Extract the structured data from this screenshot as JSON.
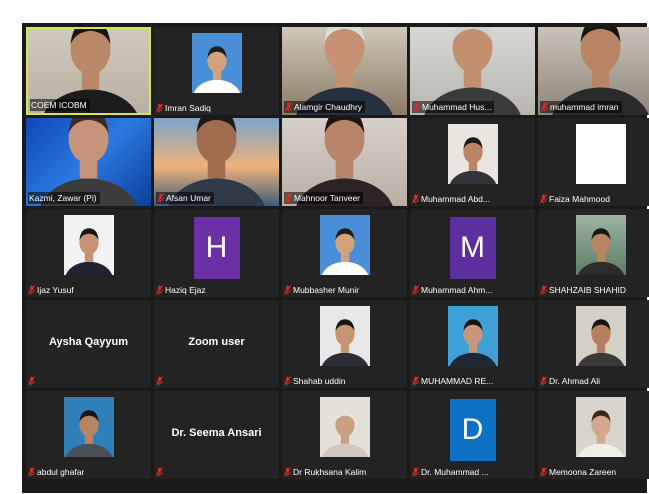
{
  "accent": "#d3e84f",
  "mute_color": "#e02b2b",
  "participants": [
    {
      "name": "COEM ICOBM",
      "mode": "video",
      "scene": "woman-dark",
      "active": true,
      "muted": false
    },
    {
      "name": "Imran Sadiq",
      "mode": "photo",
      "scene": "man-blue",
      "muted": true
    },
    {
      "name": "Alamgir Chaudhry",
      "mode": "video",
      "scene": "man-office",
      "muted": true
    },
    {
      "name": "Muhammad Hus...",
      "mode": "video",
      "scene": "man-office2",
      "muted": true
    },
    {
      "name": "muhammad imran",
      "mode": "video",
      "scene": "man-beard",
      "muted": true
    },
    {
      "name": "Kazmi, Zawar (Pi)",
      "mode": "video",
      "scene": "man-blue-bg",
      "muted": false
    },
    {
      "name": "Afsan Umar",
      "mode": "video",
      "scene": "man-bridge",
      "muted": true
    },
    {
      "name": "Mahnoor Tanveer",
      "mode": "video",
      "scene": "woman-headset",
      "muted": true
    },
    {
      "name": "Muhammad Abd...",
      "mode": "photo",
      "scene": "man-suit",
      "muted": true
    },
    {
      "name": "Faiza Mahmood",
      "mode": "photo",
      "scene": "blank",
      "muted": true
    },
    {
      "name": "Ijaz Yusuf",
      "mode": "photo",
      "scene": "man-suit2",
      "muted": true
    },
    {
      "name": "Haziq Ejaz",
      "mode": "initial",
      "initial": "H",
      "color": "#6b2fa6",
      "muted": true
    },
    {
      "name": "Mubbasher Munir",
      "mode": "photo",
      "scene": "man-blue",
      "muted": true
    },
    {
      "name": "Muhammad Ahm...",
      "mode": "initial",
      "initial": "M",
      "color": "#5c2e9e",
      "muted": true
    },
    {
      "name": "SHAHZAIB SHAHID",
      "mode": "photo",
      "scene": "man-outdoor",
      "muted": true
    },
    {
      "name": "Aysha Qayyum",
      "mode": "name",
      "muted": true
    },
    {
      "name": "Zoom user",
      "mode": "name",
      "muted": true
    },
    {
      "name": "Shahab uddin",
      "mode": "photo",
      "scene": "man-beard2",
      "muted": true
    },
    {
      "name": "MUHAMMAD RE...",
      "mode": "photo",
      "scene": "man-suit3",
      "muted": true
    },
    {
      "name": "Dr. Ahmad Ali",
      "mode": "photo",
      "scene": "man-casual",
      "muted": true
    },
    {
      "name": "abdul ghafar",
      "mode": "photo",
      "scene": "man-blue2",
      "muted": true
    },
    {
      "name": "Dr. Seema Ansari",
      "mode": "name",
      "muted": true
    },
    {
      "name": "Dr Rukhsana Kalim",
      "mode": "photo",
      "scene": "woman-hijab",
      "muted": true
    },
    {
      "name": "Dr. Muhammad ...",
      "mode": "initial",
      "initial": "D",
      "color": "#0e72c4",
      "muted": true
    },
    {
      "name": "Memoona Zareen",
      "mode": "photo",
      "scene": "woman-glasses",
      "muted": true
    }
  ]
}
